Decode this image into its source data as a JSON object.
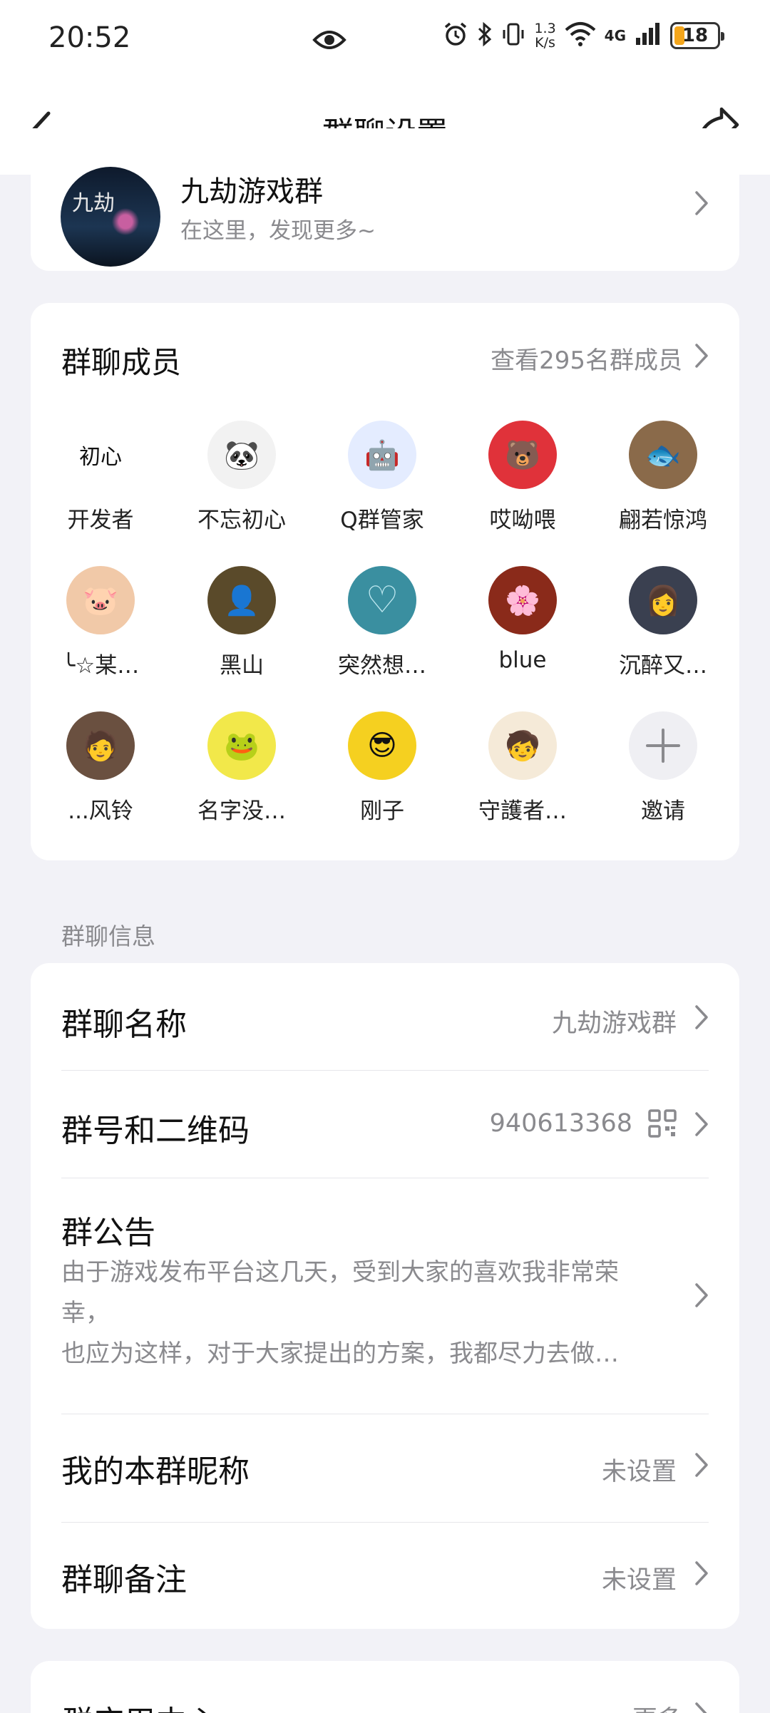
{
  "status_bar": {
    "time": "20:52",
    "net_speed_value": "1.3",
    "net_speed_unit": "K/s",
    "network": "4G",
    "battery": "18"
  },
  "nav": {
    "title": "群聊设置"
  },
  "group": {
    "avatar_text": "九劫",
    "name": "九劫游戏群",
    "subtitle": "在这里，发现更多~"
  },
  "members": {
    "title": "群聊成员",
    "view_all": "查看295名群成员",
    "items": [
      {
        "name": "开发者",
        "avatar": "初心",
        "bg": "#ffffff"
      },
      {
        "name": "不忘初心",
        "avatar": "🐼",
        "bg": "#f2f2f2"
      },
      {
        "name": "Q群管家",
        "avatar": "🤖",
        "bg": "#e4ecff"
      },
      {
        "name": "哎呦喂",
        "avatar": "🐻",
        "bg": "#e0323a"
      },
      {
        "name": "翩若惊鸿",
        "avatar": "🐟",
        "bg": "#8a6a4a"
      },
      {
        "name": "╰☆某…",
        "avatar": "🐷",
        "bg": "#f1c9a8"
      },
      {
        "name": "黑山",
        "avatar": "👤",
        "bg": "#5a4a2a"
      },
      {
        "name": "突然想…",
        "avatar": "♡",
        "bg": "#3a8fa0"
      },
      {
        "name": "blue",
        "avatar": "🌸",
        "bg": "#8a2a1a"
      },
      {
        "name": "沉醉又…",
        "avatar": "👩",
        "bg": "#3a4050"
      },
      {
        "name": "...风铃",
        "avatar": "🧑",
        "bg": "#6a5040"
      },
      {
        "name": "名字没…",
        "avatar": "🐸",
        "bg": "#f2e84a"
      },
      {
        "name": "刚子",
        "avatar": "😎",
        "bg": "#f5d020"
      },
      {
        "name": "守護者…",
        "avatar": "🧒",
        "bg": "#f5ead8"
      },
      {
        "name": "邀请",
        "avatar": "",
        "bg": "#efeff3"
      }
    ]
  },
  "info_section": {
    "label": "群聊信息",
    "group_name_label": "群聊名称",
    "group_name_value": "九劫游戏群",
    "group_id_label": "群号和二维码",
    "group_id_value": "940613368",
    "notice_label": "群公告",
    "notice_line1": "由于游戏发布平台这几天，受到大家的喜欢我非常荣",
    "notice_line2": "幸，",
    "notice_line3": "也应为这样，对于大家提出的方案，我都尽力去做…",
    "nickname_label": "我的本群昵称",
    "nickname_value": "未设置",
    "remark_label": "群聊备注",
    "remark_value": "未设置"
  },
  "apps": {
    "title": "群应用中心",
    "more": "更多"
  }
}
